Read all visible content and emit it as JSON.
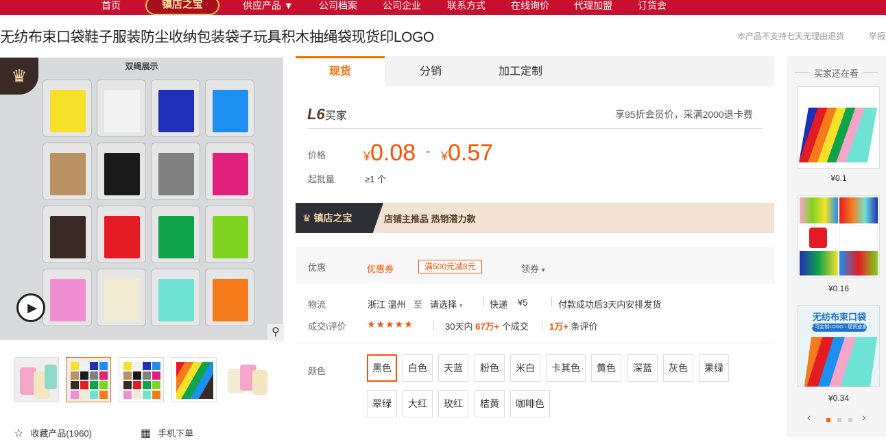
{
  "nav": {
    "items": [
      "首页",
      "供应产品 ▼",
      "公司档案",
      "公司企业",
      "联系方式",
      "在线询价",
      "代理加盟",
      "订货会"
    ],
    "badge": "镇店之宝"
  },
  "product": {
    "title": "无纺布束口袋鞋子服装防尘收纳包装袋子玩具积木抽绳袋现货印LOGO",
    "no_return_note": "本产品不支持七天无理由退货",
    "report_label": "举报"
  },
  "gallery": {
    "image_title": "双绳展示",
    "colors": [
      "#f5e12a",
      "#f2f2f2",
      "#1f2fb8",
      "#1c8ff0",
      "#b89262",
      "#1a1a1a",
      "#808080",
      "#e0207a",
      "#3a2a24",
      "#e51b24",
      "#0fa34a",
      "#7fd321",
      "#ef8ed0",
      "#f3ecd4",
      "#6fe3d3",
      "#f57a1a"
    ]
  },
  "actions": {
    "favorite_label": "收藏产品(1960)",
    "mobile_order_label": "手机下单"
  },
  "tabs": [
    "现货",
    "分销",
    "加工定制"
  ],
  "vip": {
    "level": "L6",
    "level_suffix": "买家",
    "benefit": "享95折会员价，采满2000退卡费"
  },
  "pricing": {
    "price_label": "价格",
    "currency": "¥",
    "min_price": "0.08",
    "separator": "-",
    "max_price": "0.57",
    "moq_label": "起批量",
    "moq_value": "≥1 个"
  },
  "promo": {
    "badge": "镇店之宝",
    "text": "店铺主推品  热销潜力款"
  },
  "coupon": {
    "label": "优惠",
    "type": "优惠券",
    "tag": "满500元减8元",
    "get_label": "领券",
    "get_icon": "chevron-down-icon"
  },
  "logistics": {
    "label": "物流",
    "from": "浙江 温州",
    "to_word": "至",
    "select_label": "请选择",
    "express_label": "快递",
    "express_price": "¥5",
    "ship_note": "付款成功后3天内安排发货"
  },
  "stats": {
    "label": "成交\\评价",
    "stars": "★★★★★",
    "days_prefix": "30天内",
    "sold": "67万+",
    "sold_suffix": "个成交",
    "reviews": "1万+",
    "reviews_suffix": "条评价"
  },
  "color_options": {
    "label": "颜色",
    "selected": "黑色",
    "row1": [
      "黑色",
      "白色",
      "天蓝",
      "粉色",
      "米白",
      "卡其色",
      "黄色",
      "深蓝",
      "灰色",
      "果绿"
    ],
    "row2": [
      "翠绿",
      "大红",
      "玫红",
      "桔黄",
      "咖啡色"
    ]
  },
  "sidebar": {
    "title": "买家还在看",
    "items": [
      {
        "price": "¥0.1"
      },
      {
        "price": "¥0.16"
      },
      {
        "price": "¥0.34",
        "image_text": "无纺布束口袋",
        "image_sub": "• 可定制LOGO  • 现货速发"
      }
    ],
    "prev": "‹",
    "next": "›"
  }
}
